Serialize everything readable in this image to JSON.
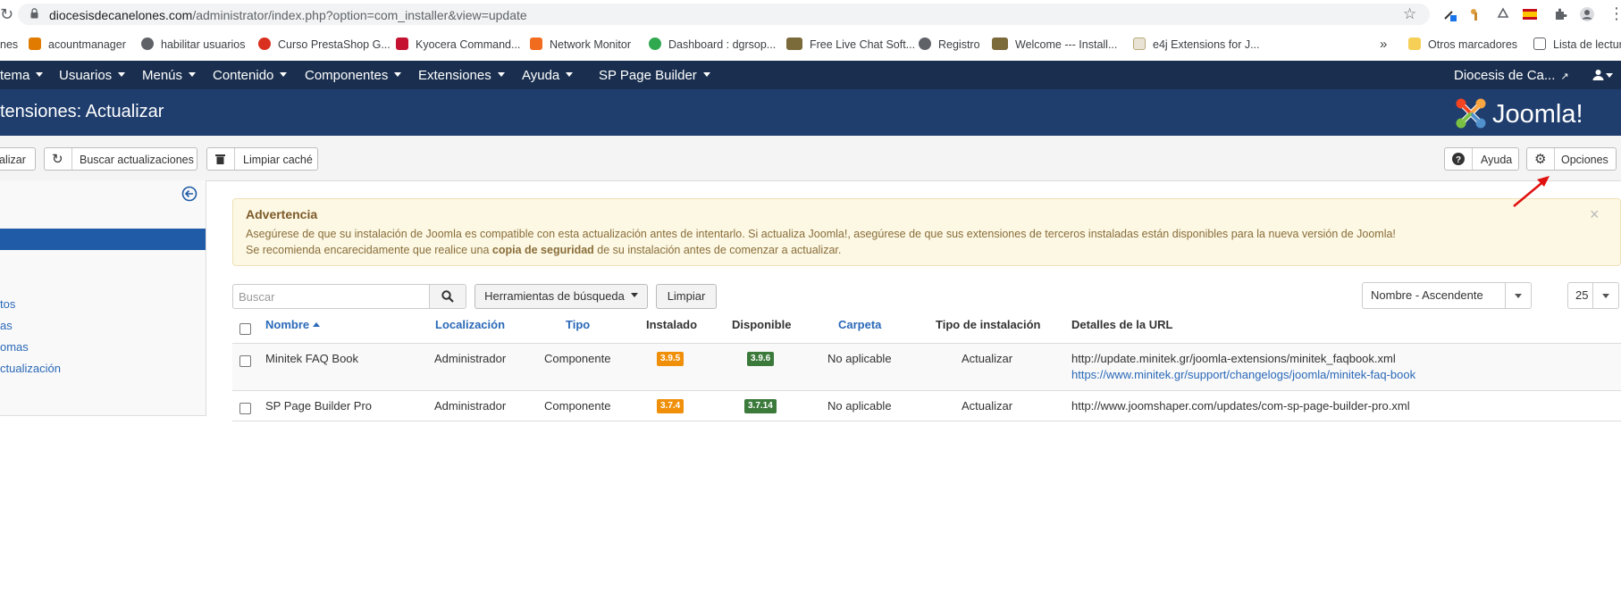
{
  "browser": {
    "url_host": "diocesisdecanelones.com",
    "url_path": "/administrator/index.php?option=com_installer&view=update",
    "bookmarks": [
      {
        "label": "nes",
        "icon": "generic-bookmark-icon"
      },
      {
        "label": "acountmanager",
        "icon": "dgr-favicon-icon"
      },
      {
        "label": "habilitar usuarios",
        "icon": "globe-icon"
      },
      {
        "label": "Curso PrestaShop G...",
        "icon": "prestashop-favicon-icon"
      },
      {
        "label": "Kyocera Command...",
        "icon": "kyocera-favicon-icon"
      },
      {
        "label": "Network Monitor",
        "icon": "network-monitor-favicon-icon"
      },
      {
        "label": "Dashboard : dgrsop...",
        "icon": "headset-favicon-icon"
      },
      {
        "label": "Free Live Chat Soft...",
        "icon": "people-favicon-icon"
      },
      {
        "label": "Registro",
        "icon": "globe-icon"
      },
      {
        "label": "Welcome --- Install...",
        "icon": "people-favicon-icon"
      },
      {
        "label": "e4j Extensions for J...",
        "icon": "e4j-favicon-icon"
      }
    ],
    "more_bookmarks": "»",
    "other_bookmarks": "Otros marcadores",
    "reading_list": "Lista de lectura"
  },
  "nav": {
    "items": [
      "tema",
      "Usuarios",
      "Menús",
      "Contenido",
      "Componentes",
      "Extensiones",
      "Ayuda",
      "SP Page Builder"
    ],
    "site_name": "Diocesis de Ca..."
  },
  "header": {
    "title": "tensiones: Actualizar",
    "logo_text": "Joomla!"
  },
  "toolbar": {
    "update_label": "alizar",
    "find_updates_label": "Buscar actualizaciones",
    "clear_cache_label": "Limpiar caché",
    "help_label": "Ayuda",
    "options_label": "Opciones"
  },
  "sidebar": {
    "items": [
      "tos",
      "as",
      "omas",
      "ctualización"
    ]
  },
  "alert": {
    "heading": "Advertencia",
    "line1": "Asegúrese de que su instalación de Joomla es compatible con esta actualización antes de intentarlo. Si actualiza Joomla!, asegúrese de que sus extensiones de terceros instaladas están disponibles para la nueva versión de Joomla!",
    "line2_before": "Se recomienda encarecidamente que realice una ",
    "line2_bold": "copia de seguridad",
    "line2_after": " de su instalación antes de comenzar a actualizar.",
    "close": "×"
  },
  "filters": {
    "search_placeholder": "Buscar",
    "search_tools_label": "Herramientas de búsqueda",
    "clear_label": "Limpiar",
    "sort_value": "Nombre - Ascendente",
    "limit_value": "25"
  },
  "table": {
    "columns": {
      "name": "Nombre",
      "location": "Localización",
      "type": "Tipo",
      "installed": "Instalado",
      "available": "Disponible",
      "folder": "Carpeta",
      "install_type": "Tipo de instalación",
      "url_details": "Detalles de la URL"
    },
    "rows": [
      {
        "name": "Minitek FAQ Book",
        "location": "Administrador",
        "type": "Componente",
        "installed": "3.9.5",
        "available": "3.9.6",
        "folder": "No aplicable",
        "install_type": "Actualizar",
        "url": "http://update.minitek.gr/joomla-extensions/minitek_faqbook.xml",
        "changelog": "https://www.minitek.gr/support/changelogs/joomla/minitek-faq-book"
      },
      {
        "name": "SP Page Builder Pro",
        "location": "Administrador",
        "type": "Componente",
        "installed": "3.7.4",
        "available": "3.7.14",
        "folder": "No aplicable",
        "install_type": "Actualizar",
        "url": "http://www.joomshaper.com/updates/com-sp-page-builder-pro.xml"
      }
    ]
  },
  "colors": {
    "navbar": "#1a2f4f",
    "header": "#1f3e6e",
    "installed_badge": "#f0900a",
    "available_badge": "#3b7a3b",
    "link": "#2a69b8"
  }
}
